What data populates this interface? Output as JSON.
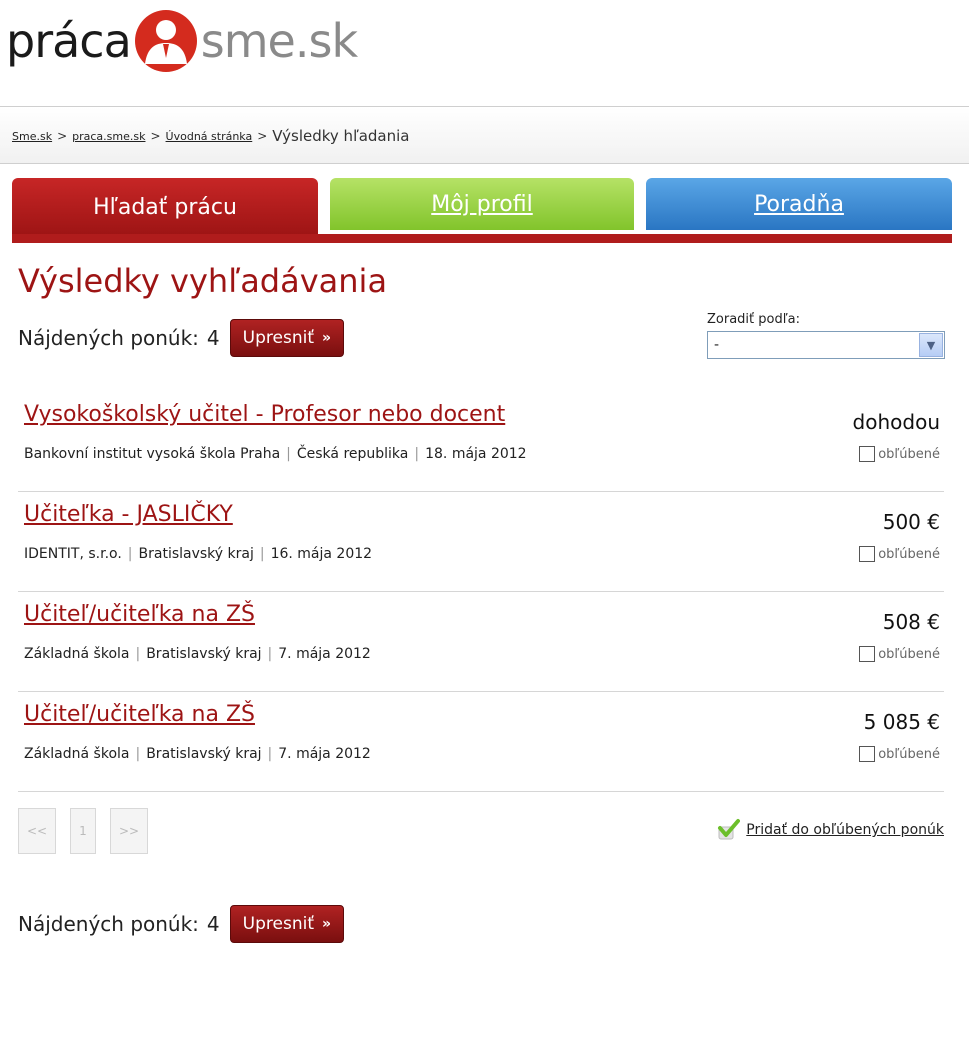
{
  "logo": {
    "part1": "práca",
    "part2": "sme.sk",
    "icon": "person-silhouette-icon",
    "accent": "#d42b1e"
  },
  "breadcrumb": {
    "items": [
      "Sme.sk",
      "praca.sme.sk",
      "Úvodná stránka"
    ],
    "separator": ">",
    "current": "Výsledky hľadania"
  },
  "tabs": [
    {
      "label": "Hľadať prácu",
      "color": "#b01c1c",
      "active": true
    },
    {
      "label": "Môj profil",
      "color": "#8cc63f",
      "active": false
    },
    {
      "label": "Poradňa",
      "color": "#3a86d0",
      "active": false
    }
  ],
  "main": {
    "title": "Výsledky vyhľadávania",
    "found_label": "Nájdených ponúk:",
    "found_count": "4",
    "refine_label": "Upresniť",
    "sort_label": "Zoradiť podľa:",
    "sort_value": "-"
  },
  "results": [
    {
      "title": "Vysokoškolský učitel - Profesor nebo docent",
      "company": "Bankovní institut vysoká škola Praha",
      "location": "Česká republika",
      "date": "18. mája 2012",
      "salary": "dohodou",
      "fav_label": "obľúbené"
    },
    {
      "title": "Učiteľka - JASLIČKY",
      "company": "IDENTIT, s.r.o.",
      "location": "Bratislavský kraj",
      "date": "16. mája 2012",
      "salary": "500 €",
      "fav_label": "obľúbené"
    },
    {
      "title": "Učiteľ/učiteľka na ZŠ",
      "company": "Základná škola",
      "location": "Bratislavský kraj",
      "date": "7. mája 2012",
      "salary": "508 €",
      "fav_label": "obľúbené"
    },
    {
      "title": "Učiteľ/učiteľka na ZŠ",
      "company": "Základná škola",
      "location": "Bratislavský kraj",
      "date": "7. mája 2012",
      "salary": "5 085 €",
      "fav_label": "obľúbené"
    }
  ],
  "pager": {
    "first": "<<",
    "page": "1",
    "next": ">>"
  },
  "add_fav": {
    "label": "Pridať do obľúbených ponúk",
    "icon": "green-check-icon"
  },
  "footer": {
    "found_label": "Nájdených ponúk:",
    "found_count": "4",
    "refine_label": "Upresniť"
  }
}
